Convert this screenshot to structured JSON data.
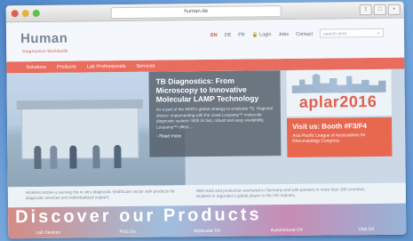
{
  "browser": {
    "url": "human.de",
    "window_buttons": [
      "",
      "",
      ""
    ]
  },
  "header": {
    "logo": "Human",
    "logo_sub": "Diagnostics Worldwide",
    "languages": [
      "EN",
      "DE",
      "FR"
    ],
    "links": [
      "Login",
      "Jobs",
      "Contact"
    ],
    "search_placeholder": "search term"
  },
  "mainnav": {
    "items": [
      "Solutions",
      "Products",
      "Lab Professionals",
      "Services"
    ]
  },
  "hero": {
    "title": "TB Diagnostics: From Microscopy to Innovative Molecular LAMP Technology",
    "text": "As a part of the WHO's global strategy to eradicate TB, Regional drivers' implementing with the novel Loopamp™ molecular diagnostic system: With its fast, robust and easy availability, Loopamp™ offers ...",
    "more": "› Read more"
  },
  "event": {
    "logo_text": "aplar2016",
    "visit_title": "Visit us: Booth #F3/F4",
    "visit_sub": "Asia Pacific League of Associations for Rheumatology Congress"
  },
  "textrow": {
    "col1": "HUMAN GmbH is serving the in vitro diagnostic healthcare sector with products for diagnostic services and individualized support.",
    "col2": "With R&D and production anchored in Germany and with partners in more than 160 countries, HUMAN is regarded a global player in the IVD industry."
  },
  "products": {
    "banner": "Discover our Products",
    "tabs": [
      "Lab Devices",
      "POC Dx",
      "Molecular DX",
      "Autoimmune DX",
      "Vital DX"
    ]
  }
}
